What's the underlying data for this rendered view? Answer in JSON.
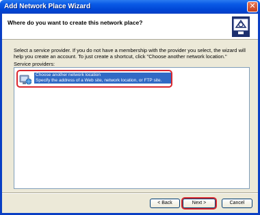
{
  "window": {
    "title": "Add Network Place Wizard"
  },
  "header": {
    "title": "Where do you want to create this network place?"
  },
  "main": {
    "description": "Select a service provider.  If you do not have a membership with the provider you select, the wizard will help you create an account.  To just create a shortcut, click \"Choose another network location.\"",
    "providers_label": "Service providers:",
    "providers": [
      {
        "name": "Choose another network location",
        "detail": "Specify the address of a Web site, network location, or FTP site.",
        "icon": "network-globe-icon",
        "selected": true
      }
    ]
  },
  "buttons": {
    "back": "< Back",
    "next": "Next >",
    "cancel": "Cancel"
  },
  "colors": {
    "titlebar": "#0a5ae6",
    "selection": "#316ac5",
    "highlight": "#d9262d",
    "dialog": "#ece9d8"
  }
}
